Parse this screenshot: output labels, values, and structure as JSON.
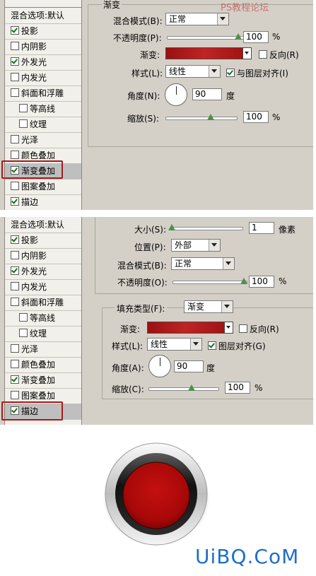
{
  "panel1": {
    "sidebar": {
      "header": "混合选项:默认",
      "items": [
        {
          "label": "投影",
          "checked": true,
          "sub": false
        },
        {
          "label": "内阴影",
          "checked": false,
          "sub": false
        },
        {
          "label": "外发光",
          "checked": true,
          "sub": false
        },
        {
          "label": "内发光",
          "checked": false,
          "sub": false
        },
        {
          "label": "斜面和浮雕",
          "checked": false,
          "sub": false
        },
        {
          "label": "等高线",
          "checked": false,
          "sub": true
        },
        {
          "label": "纹理",
          "checked": false,
          "sub": true
        },
        {
          "label": "光泽",
          "checked": false,
          "sub": false
        },
        {
          "label": "颜色叠加",
          "checked": false,
          "sub": false
        },
        {
          "label": "渐变叠加",
          "checked": true,
          "sub": false,
          "selected": true
        },
        {
          "label": "图案叠加",
          "checked": false,
          "sub": false
        },
        {
          "label": "描边",
          "checked": true,
          "sub": false
        }
      ]
    },
    "section_title": "渐变",
    "blend_mode_label": "混合模式(B):",
    "blend_mode_value": "正常",
    "opacity_label": "不透明度(P):",
    "opacity_value": "100",
    "opacity_unit": "%",
    "gradient_label": "渐变:",
    "reverse_label": "反向(R)",
    "reverse_checked": false,
    "style_label": "样式(L):",
    "style_value": "线性",
    "align_label": "与图层对齐(I)",
    "align_checked": true,
    "angle_label": "角度(N):",
    "angle_value": "90",
    "angle_unit": "度",
    "scale_label": "缩放(S):",
    "scale_value": "100",
    "scale_unit": "%",
    "watermark": "PS教程论坛"
  },
  "panel2": {
    "sidebar": {
      "header": "混合选项:默认",
      "items": [
        {
          "label": "投影",
          "checked": true,
          "sub": false
        },
        {
          "label": "内阴影",
          "checked": false,
          "sub": false
        },
        {
          "label": "外发光",
          "checked": true,
          "sub": false
        },
        {
          "label": "内发光",
          "checked": false,
          "sub": false
        },
        {
          "label": "斜面和浮雕",
          "checked": false,
          "sub": false
        },
        {
          "label": "等高线",
          "checked": false,
          "sub": true
        },
        {
          "label": "纹理",
          "checked": false,
          "sub": true
        },
        {
          "label": "光泽",
          "checked": false,
          "sub": false
        },
        {
          "label": "颜色叠加",
          "checked": false,
          "sub": false
        },
        {
          "label": "渐变叠加",
          "checked": true,
          "sub": false
        },
        {
          "label": "图案叠加",
          "checked": false,
          "sub": false
        },
        {
          "label": "描边",
          "checked": true,
          "sub": false,
          "selected": true
        }
      ]
    },
    "size_label": "大小(S):",
    "size_value": "1",
    "size_unit": "像素",
    "position_label": "位置(P):",
    "position_value": "外部",
    "blend_mode_label": "混合模式(B):",
    "blend_mode_value": "正常",
    "opacity_label": "不透明度(O):",
    "opacity_value": "100",
    "opacity_unit": "%",
    "fill_type_label": "填充类型(F):",
    "fill_type_value": "渐变",
    "gradient_label": "渐变:",
    "reverse_label": "反向(R)",
    "reverse_checked": false,
    "style_label": "样式(L):",
    "style_value": "线性",
    "align_label": "图层对齐(G)",
    "align_checked": true,
    "angle_label": "角度(A):",
    "angle_value": "90",
    "angle_unit": "度",
    "scale_label": "缩放(C):",
    "scale_value": "100",
    "scale_unit": "%"
  },
  "brand": "UiBQ.CoM",
  "colors": {
    "highlight": "#a81a1a",
    "button_red": "#c41010",
    "brand_blue": "#1e6fc8"
  }
}
